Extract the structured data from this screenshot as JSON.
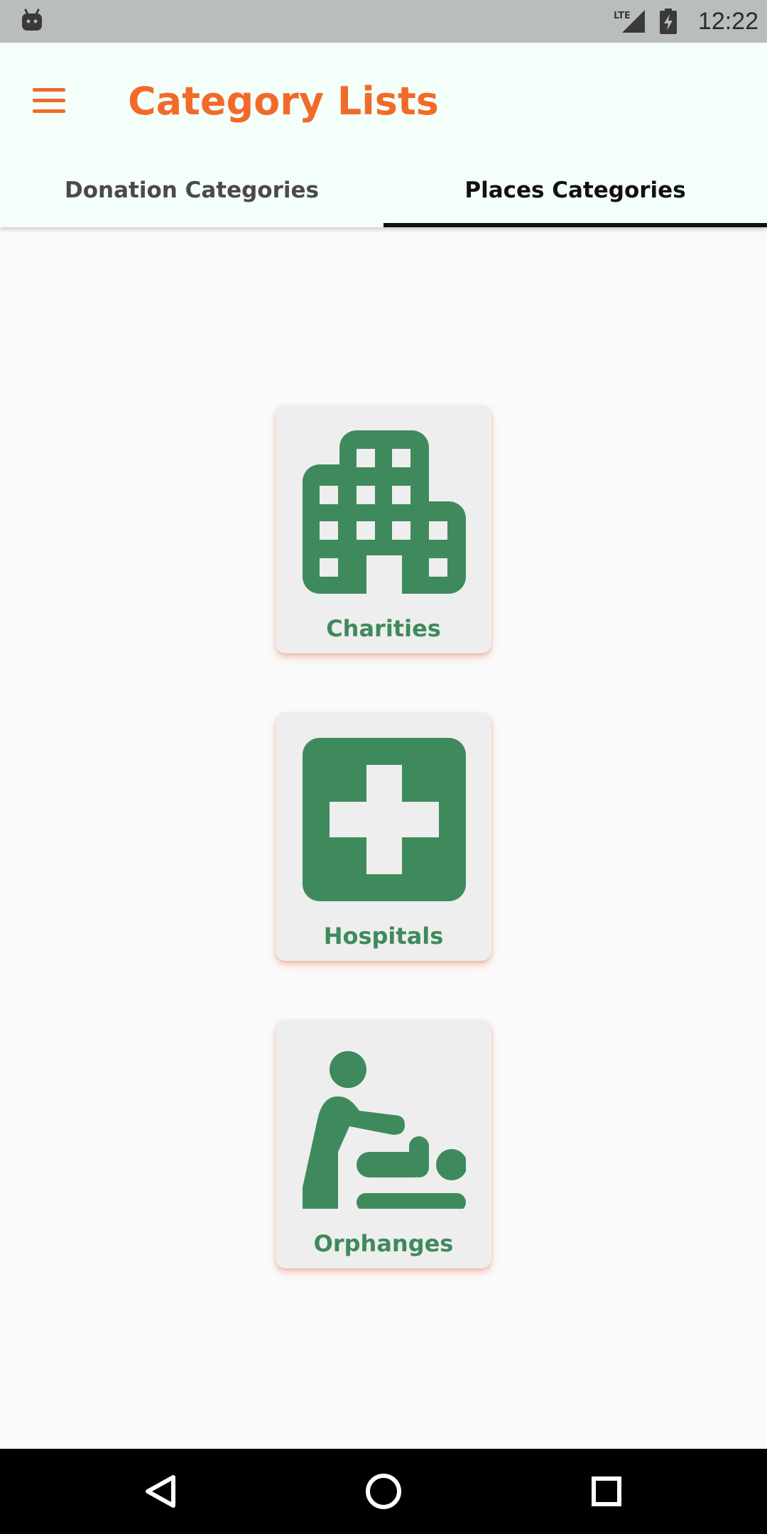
{
  "status_bar": {
    "time": "12:22",
    "network_label": "LTE",
    "icons": [
      "android-icon",
      "signal-icon",
      "battery-charging-icon"
    ]
  },
  "app_bar": {
    "title": "Category Lists",
    "menu_icon": "hamburger-menu-icon",
    "title_color": "#f26a2a"
  },
  "tabs": [
    {
      "label": "Donation Categories",
      "selected": false
    },
    {
      "label": "Places Categories",
      "selected": true
    }
  ],
  "categories": [
    {
      "label": "Charities",
      "icon": "building-icon"
    },
    {
      "label": "Hospitals",
      "icon": "medical-cross-icon"
    },
    {
      "label": "Orphanges",
      "icon": "baby-changing-icon"
    }
  ],
  "colors": {
    "accent": "#f26a2a",
    "icon_green": "#3f8a5c",
    "app_bar_bg": "#f5fff9",
    "status_bar_bg": "#babdbe"
  },
  "nav_bar": {
    "icons": [
      "back-icon",
      "home-icon",
      "recents-icon"
    ]
  }
}
